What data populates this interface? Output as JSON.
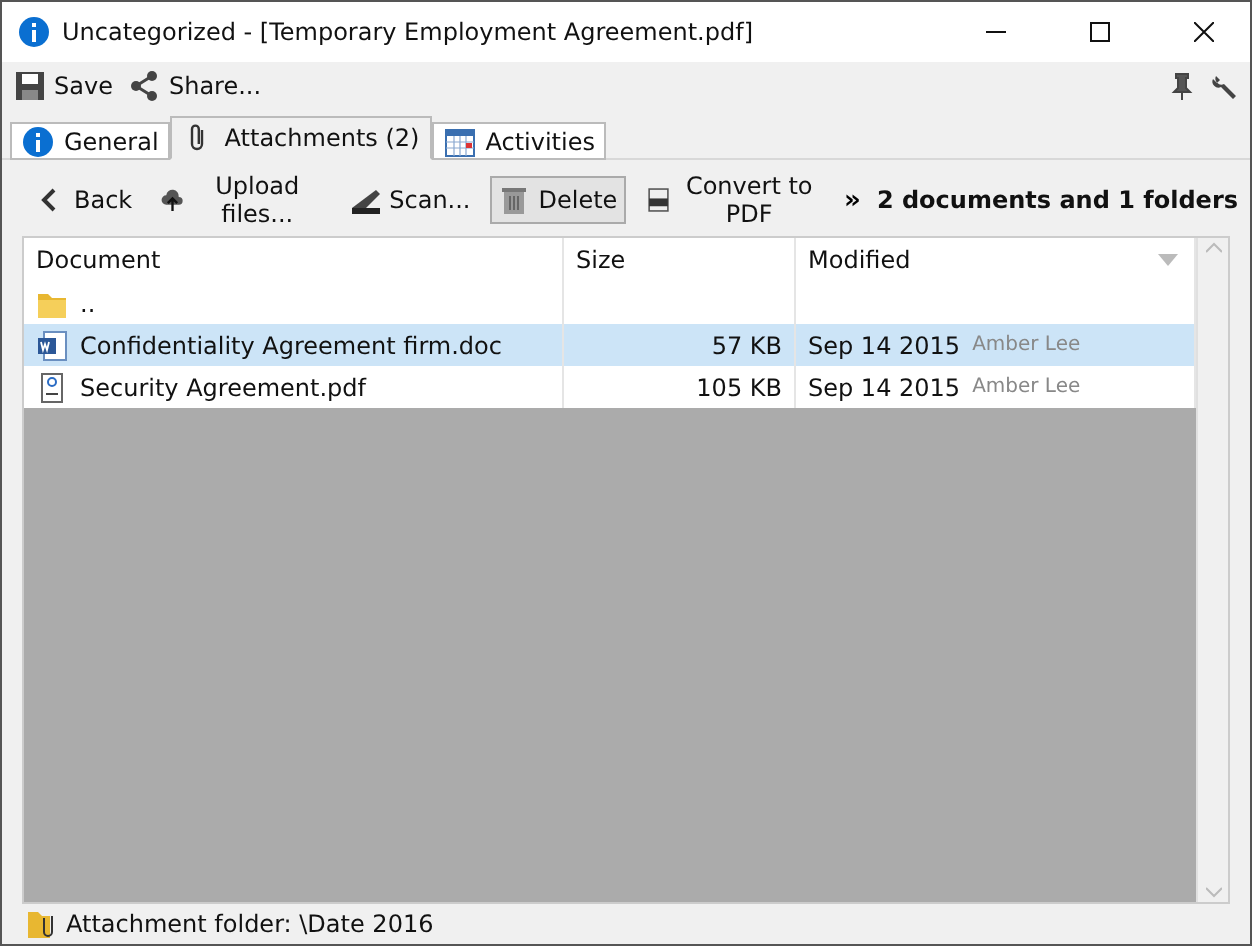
{
  "window": {
    "title": "Uncategorized - [Temporary Employment Agreement.pdf]"
  },
  "toolbar": [
    {
      "kind": "save",
      "label": "Save"
    },
    {
      "kind": "share",
      "label": "Share..."
    }
  ],
  "tabs": [
    {
      "kind": "info",
      "label": "General",
      "selected": false
    },
    {
      "kind": "clip",
      "label": "Attachments (2)",
      "selected": true
    },
    {
      "kind": "calendar",
      "label": "Activities",
      "selected": false
    }
  ],
  "actions": [
    {
      "kind": "back",
      "label": "Back",
      "pressed": false
    },
    {
      "kind": "upload",
      "label": "Upload files...",
      "pressed": false
    },
    {
      "kind": "scan",
      "label": "Scan...",
      "pressed": false
    },
    {
      "kind": "delete",
      "label": "Delete",
      "pressed": true
    },
    {
      "kind": "pdf",
      "label": "Convert to PDF",
      "pressed": false
    }
  ],
  "more": "»",
  "summary": "2 documents and 1 folders",
  "table": {
    "columns": [
      "Document",
      "Size",
      "Modified"
    ],
    "rows": [
      {
        "kind": "folder",
        "name": "..",
        "selected": false
      },
      {
        "kind": "doc",
        "name": "Confidentiality Agreement firm.doc",
        "size": "57 KB",
        "date": "Sep 14 2015",
        "author": "Amber Lee",
        "selected": true
      },
      {
        "kind": "pdf",
        "name": "Security Agreement.pdf",
        "size": "105 KB",
        "date": "Sep 14 2015",
        "author": "Amber Lee",
        "selected": false
      }
    ]
  },
  "status_bar": {
    "text": "Attachment folder: \\Date 2016"
  }
}
